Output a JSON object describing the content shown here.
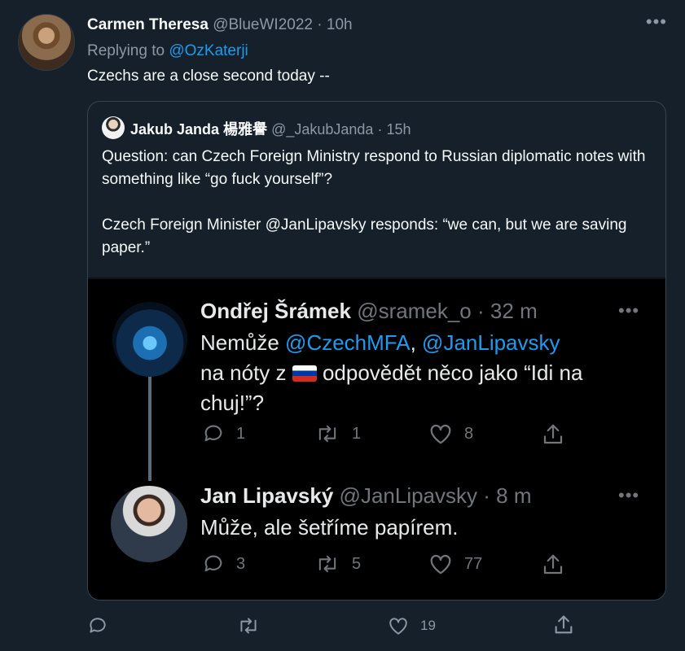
{
  "tweet": {
    "author_name": "Carmen Theresa",
    "handle": "@BlueWI2022",
    "separator": "·",
    "time": "10h",
    "more": "•••",
    "replying_prefix": "Replying to",
    "replying_to": "@OzKaterji",
    "text": "Czechs are a close second today --"
  },
  "quote": {
    "author_name": "Jakub Janda 楊雅譽",
    "handle": "@_JakubJanda",
    "separator": "·",
    "time": "15h",
    "paragraph1": "Question: can Czech Foreign Ministry respond to Russian diplomatic notes with something like “go fuck yourself”?",
    "paragraph2": "Czech Foreign Minister @JanLipavsky responds: “we can, but we are saving paper.”"
  },
  "image": {
    "t1": {
      "name": "Ondřej Šrámek",
      "handle": "@sramek_o",
      "separator": "·",
      "time": "32 m",
      "more": "•••",
      "text_a": "Nemůže ",
      "mention1": "@CzechMFA",
      "text_b": ", ",
      "mention2": "@JanLipavsky",
      "text_c": " na nóty z ",
      "text_d": " odpovědět něco jako “Idi na chuj!”?",
      "replies": "1",
      "retweets": "1",
      "likes": "8"
    },
    "t2": {
      "name": "Jan Lipavský",
      "handle": "@JanLipavsky",
      "separator": "·",
      "time": "8 m",
      "more": "•••",
      "text": "Může, ale šetříme papírem.",
      "replies": "3",
      "retweets": "5",
      "likes": "77"
    }
  },
  "actions": {
    "reply_count": "",
    "retweet_count": "",
    "like_count": "19"
  },
  "colors": {
    "background": "#15202b",
    "accent": "#1d9bf0",
    "muted": "#8b98a5"
  }
}
